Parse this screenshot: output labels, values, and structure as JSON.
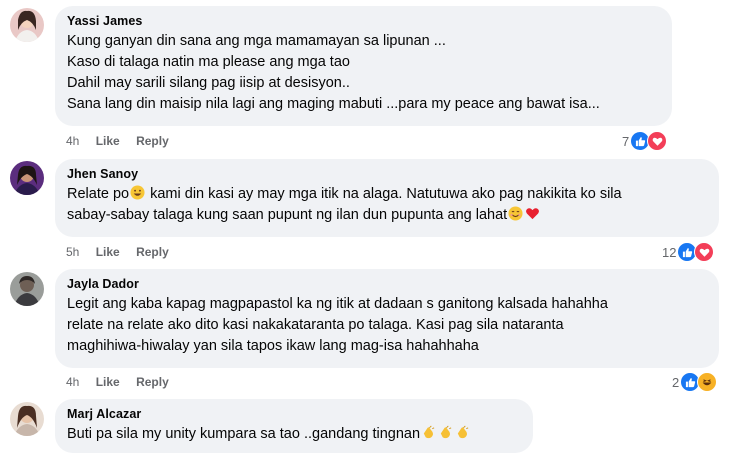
{
  "comments": [
    {
      "author": "Yassi James",
      "lines": [
        "Kung ganyan din sana ang mga mamamayan sa lipunan ...",
        "Kaso di talaga natin ma please ang mga tao",
        "Dahil may sarili silang pag iisip at desisyon..",
        "Sana lang din maisip nila lagi ang maging mabuti ...para my peace ang bawat isa..."
      ],
      "time": "4h",
      "like_label": "Like",
      "reply_label": "Reply",
      "reaction_count": "7",
      "reactions": [
        "like-icon",
        "love-icon"
      ]
    },
    {
      "author": "Jhen Sanoy",
      "line1_a": "Relate po",
      "line1_b": " kami din kasi ay may mga itik na alaga. Natutuwa ako pag nakikita ko sila",
      "line2": "sabay-sabay talaga kung saan pupunt ng ilan dun pupunta ang lahat",
      "time": "5h",
      "like_label": "Like",
      "reply_label": "Reply",
      "reaction_count": "12",
      "reactions": [
        "like-icon",
        "love-icon"
      ]
    },
    {
      "author": "Jayla Dador",
      "lines": [
        "Legit ang kaba kapag magpapastol ka ng itik at dadaan s ganitong kalsada hahahha",
        "relate na relate ako dito kasi nakakataranta po talaga. Kasi pag sila nataranta",
        "maghihiwa-hiwalay yan sila tapos ikaw lang mag-isa hahahhaha"
      ],
      "time": "4h",
      "like_label": "Like",
      "reply_label": "Reply",
      "reaction_count": "2",
      "reactions": [
        "like-icon",
        "haha-icon"
      ]
    },
    {
      "author": "Marj Alcazar",
      "line1": "Buti pa sila my unity kumpara sa tao ..gandang tingnan"
    }
  ],
  "colors": {
    "bubble": "#f0f2f5",
    "meta_text": "#65676b",
    "like": "#1877f2",
    "love": "#f33e58",
    "haha": "#f7b125"
  }
}
